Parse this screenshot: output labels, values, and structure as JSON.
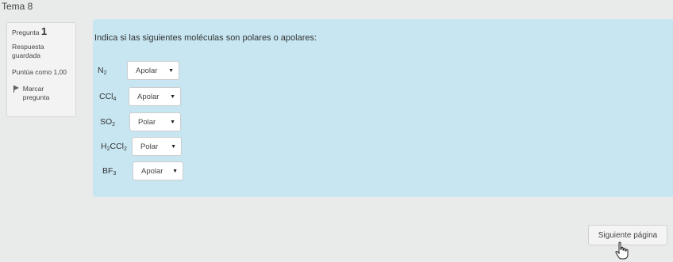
{
  "page": {
    "title": "Tema 8"
  },
  "question_info": {
    "label": "Pregunta",
    "number": "1",
    "state": "Respuesta guardada",
    "grade": "Puntúa como 1,00",
    "flag_label": "Marcar pregunta"
  },
  "question": {
    "prompt": "Indica si las siguientes moléculas son polares o apolares:",
    "items": [
      {
        "formula": [
          [
            "N",
            ""
          ],
          [
            "2",
            "sub"
          ]
        ],
        "answer": "Apolar"
      },
      {
        "formula": [
          [
            "CCl",
            ""
          ],
          [
            "4",
            "sub"
          ]
        ],
        "answer": "Apolar"
      },
      {
        "formula": [
          [
            "SO",
            ""
          ],
          [
            "2",
            "sub"
          ]
        ],
        "answer": "Polar"
      },
      {
        "formula": [
          [
            "H",
            ""
          ],
          [
            "2",
            "sub"
          ],
          [
            "CCl",
            ""
          ],
          [
            "2",
            "sub"
          ]
        ],
        "answer": "Polar"
      },
      {
        "formula": [
          [
            "BF",
            ""
          ],
          [
            "3",
            "sub"
          ]
        ],
        "answer": "Apolar"
      }
    ]
  },
  "navigation": {
    "next_label": "Siguiente página"
  },
  "icons": {
    "caret": "caret-down-icon",
    "flag": "flag-icon",
    "cursor": "hand-cursor-icon"
  },
  "colors": {
    "content_bg": "#c7e6f1",
    "page_bg": "#e9eaea"
  }
}
